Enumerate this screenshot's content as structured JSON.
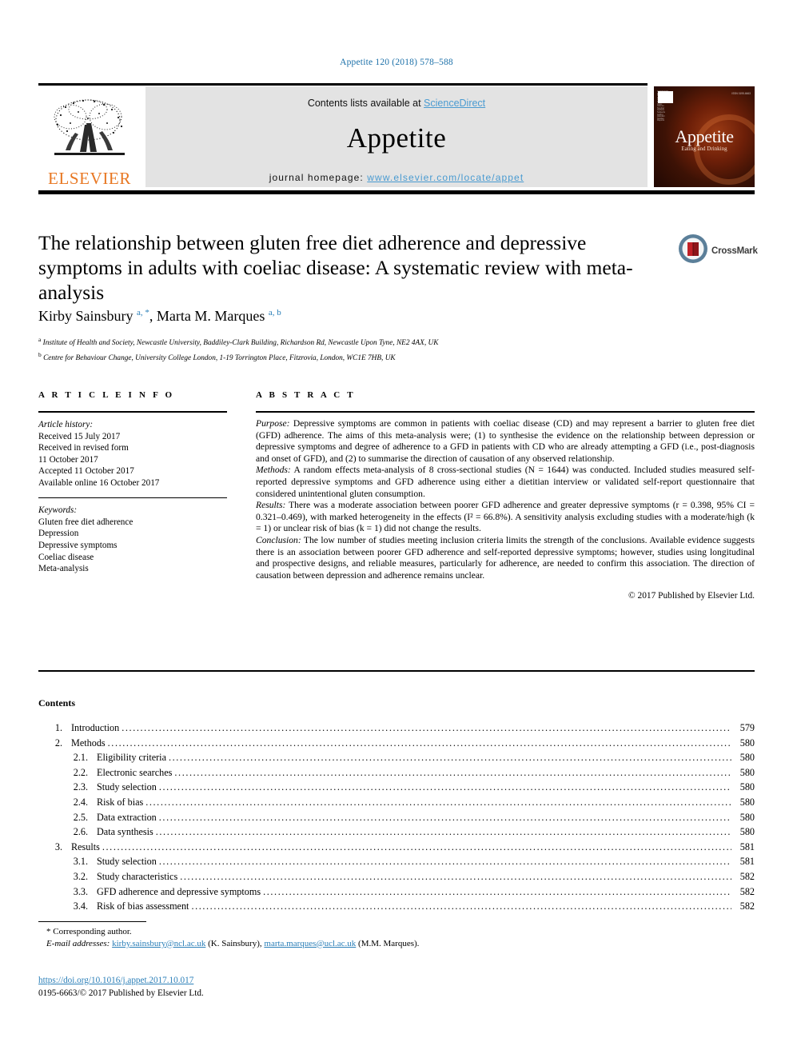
{
  "running_head": "Appetite 120 (2018) 578–588",
  "masthead": {
    "contents_prefix": "Contents lists available at ",
    "sciencedirect": "ScienceDirect",
    "journal_name": "Appetite",
    "homepage_prefix": "journal homepage: ",
    "homepage_url": "www.elsevier.com/locate/appet",
    "publisher_wordmark": "ELSEVIER",
    "cover_title": "Appetite",
    "cover_subtitle": "Eating and Drinking"
  },
  "article": {
    "title": "The relationship between gluten free diet adherence and depressive symptoms in adults with coeliac disease: A systematic review with meta-analysis",
    "authors_html": "Kirby Sainsbury <sup>a, *</sup>, Marta M. Marques <sup>a, b</sup>",
    "affiliation_a": "Institute of Health and Society, Newcastle University, Baddiley-Clark Building, Richardson Rd, Newcastle Upon Tyne, NE2 4AX, UK",
    "affiliation_b": "Centre for Behaviour Change, University College London, 1-19 Torrington Place, Fitzrovia, London, WC1E 7HB, UK",
    "crossmark_label": "CrossMark"
  },
  "article_info": {
    "heading": "A R T I C L E  I N F O",
    "history_label": "Article history:",
    "history": [
      "Received 15 July 2017",
      "Received in revised form",
      "11 October 2017",
      "Accepted 11 October 2017",
      "Available online 16 October 2017"
    ],
    "keywords_label": "Keywords:",
    "keywords": [
      "Gluten free diet adherence",
      "Depression",
      "Depressive symptoms",
      "Coeliac disease",
      "Meta-analysis"
    ]
  },
  "abstract": {
    "heading": "A B S T R A C T",
    "purpose_label": "Purpose:",
    "purpose_text": " Depressive symptoms are common in patients with coeliac disease (CD) and may represent a barrier to gluten free diet (GFD) adherence. The aims of this meta-analysis were; (1) to synthesise the evidence on the relationship between depression or depressive symptoms and degree of adherence to a GFD in patients with CD who are already attempting a GFD (i.e., post-diagnosis and onset of GFD), and (2) to summarise the direction of causation of any observed relationship.",
    "methods_label": "Methods:",
    "methods_text": " A random effects meta-analysis of 8 cross-sectional studies (N = 1644) was conducted. Included studies measured self-reported depressive symptoms and GFD adherence using either a dietitian interview or validated self-report questionnaire that considered unintentional gluten consumption.",
    "results_label": "Results:",
    "results_text": " There was a moderate association between poorer GFD adherence and greater depressive symptoms (r = 0.398, 95% CI = 0.321–0.469), with marked heterogeneity in the effects (I² = 66.8%). A sensitivity analysis excluding studies with a moderate/high (k = 1) or unclear risk of bias (k = 1) did not change the results.",
    "conclusion_label": "Conclusion:",
    "conclusion_text": " The low number of studies meeting inclusion criteria limits the strength of the conclusions. Available evidence suggests there is an association between poorer GFD adherence and self-reported depressive symptoms; however, studies using longitudinal and prospective designs, and reliable measures, particularly for adherence, are needed to confirm this association. The direction of causation between depression and adherence remains unclear.",
    "copyright": "© 2017 Published by Elsevier Ltd."
  },
  "contents": {
    "heading": "Contents",
    "entries": [
      {
        "num": "1.",
        "label": "Introduction",
        "page": "579",
        "level": 1
      },
      {
        "num": "2.",
        "label": "Methods",
        "page": "580",
        "level": 1
      },
      {
        "num": "2.1.",
        "label": "Eligibility criteria",
        "page": "580",
        "level": 2
      },
      {
        "num": "2.2.",
        "label": "Electronic searches",
        "page": "580",
        "level": 2
      },
      {
        "num": "2.3.",
        "label": "Study selection",
        "page": "580",
        "level": 2
      },
      {
        "num": "2.4.",
        "label": "Risk of bias",
        "page": "580",
        "level": 2
      },
      {
        "num": "2.5.",
        "label": "Data extraction",
        "page": "580",
        "level": 2
      },
      {
        "num": "2.6.",
        "label": "Data synthesis",
        "page": "580",
        "level": 2
      },
      {
        "num": "3.",
        "label": "Results",
        "page": "581",
        "level": 1
      },
      {
        "num": "3.1.",
        "label": "Study selection",
        "page": "581",
        "level": 2
      },
      {
        "num": "3.2.",
        "label": "Study characteristics",
        "page": "582",
        "level": 2
      },
      {
        "num": "3.3.",
        "label": "GFD adherence and depressive symptoms",
        "page": "582",
        "level": 2
      },
      {
        "num": "3.4.",
        "label": "Risk of bias assessment",
        "page": "582",
        "level": 2
      }
    ]
  },
  "footer": {
    "corresponding_author": "* Corresponding author.",
    "email_label": "E-mail addresses:",
    "email_1": "kirby.sainsbury@ncl.ac.uk",
    "email_1_name": " (K. Sainsbury), ",
    "email_2": "marta.marques@ucl.ac.uk",
    "email_2_name": " (M.M. Marques).",
    "doi": "https://doi.org/10.1016/j.appet.2017.10.017",
    "issn_line": "0195-6663/© 2017 Published by Elsevier Ltd."
  },
  "colors": {
    "link_blue": "#2b7fb8",
    "elsevier_orange": "#e87722",
    "sciencedirect_blue": "#4a9bd1",
    "cover_dark": "#2b0d07"
  }
}
